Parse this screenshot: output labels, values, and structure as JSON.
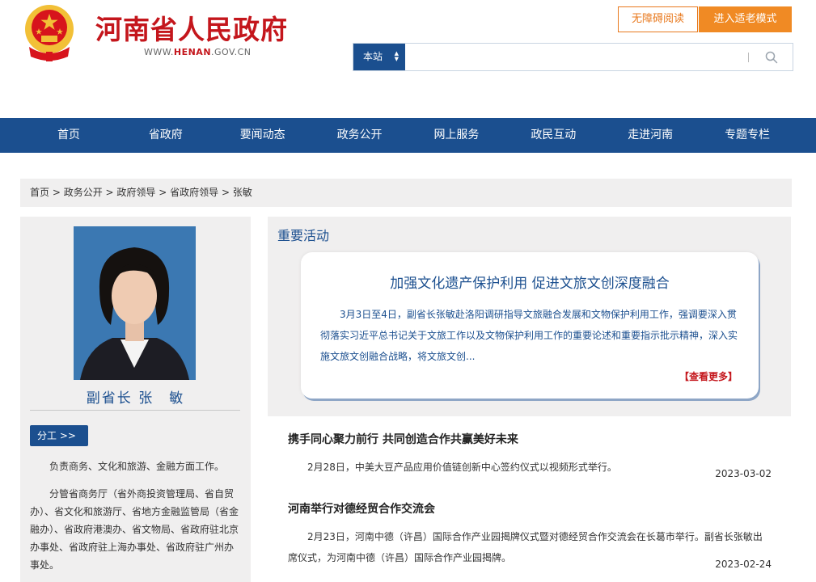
{
  "header": {
    "title": "河南省人民政府",
    "url_prefix": "WWW.",
    "url_brand": "HENAN",
    "url_suffix": ".GOV.CN",
    "accessible_label": "无障碍阅读",
    "elder_mode_label": "进入适老模式",
    "search": {
      "scope": "本站",
      "placeholder": ""
    }
  },
  "nav": {
    "items": [
      "首页",
      "省政府",
      "要闻动态",
      "政务公开",
      "网上服务",
      "政民互动",
      "走进河南",
      "专题专栏"
    ]
  },
  "breadcrumb": {
    "items": [
      "首页",
      "政务公开",
      "政府领导",
      "省政府领导",
      "张敏"
    ],
    "separator": " > "
  },
  "leader": {
    "caption": "副省长 张　敏",
    "duty_label": "分工  >>",
    "duty_p1": "负责商务、文化和旅游、金融方面工作。",
    "duty_p2": "分管省商务厅（省外商投资管理局、省自贸办）、省文化和旅游厅、省地方金融监管局（省金融办）、省政府港澳办、省文物局、省政府驻北京办事处、省政府驻上海办事处、省政府驻广州办事处。"
  },
  "activities": {
    "heading": "重要活动",
    "feature": {
      "title": "加强文化遗产保护利用 促进文旅文创深度融合",
      "body": "3月3日至4日，副省长张敏赴洛阳调研指导文旅融合发展和文物保护利用工作，强调要深入贯彻落实习近平总书记关于文旅工作以及文物保护利用工作的重要论述和重要指示批示精神，深入实施文旅文创融合战略，将文旅文创...",
      "more_label": "【查看更多】"
    },
    "news": [
      {
        "title": "携手同心聚力前行 共同创造合作共赢美好未来",
        "desc": "2月28日，中美大豆产品应用价值链创新中心签约仪式以视频形式举行。",
        "date": "2023-03-02"
      },
      {
        "title": "河南举行对德经贸合作交流会",
        "desc": "2月23日，河南中德（许昌）国际合作产业园揭牌仪式暨对德经贸合作交流会在长葛市举行。副省长张敏出席仪式，为河南中德（许昌）国际合作产业园揭牌。",
        "date": "2023-02-24"
      }
    ]
  },
  "colors": {
    "brand_red": "#c4161c",
    "nav_blue": "#1b4f8f",
    "accent_orange": "#f08a24",
    "panel_gray": "#f0efef"
  }
}
